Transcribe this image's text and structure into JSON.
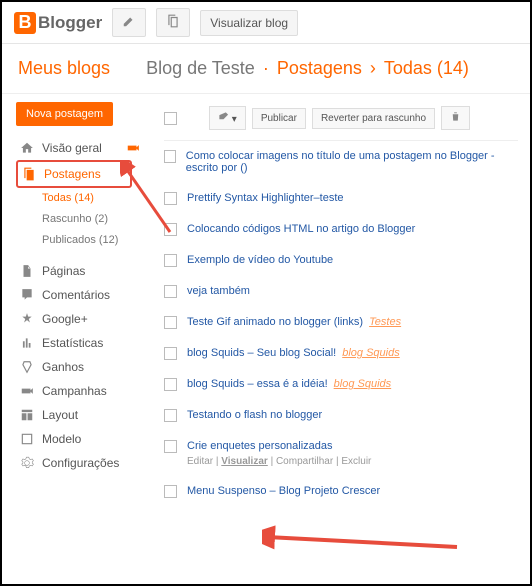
{
  "header": {
    "logo": "Blogger",
    "viewBlog": "Visualizar blog"
  },
  "title": {
    "myBlogs": "Meus blogs",
    "blogName": "Blog de Teste",
    "section": "Postagens",
    "filter": "Todas (14)"
  },
  "sidebar": {
    "newPost": "Nova postagem",
    "items": [
      {
        "label": "Visão geral"
      },
      {
        "label": "Postagens"
      },
      {
        "label": "Páginas"
      },
      {
        "label": "Comentários"
      },
      {
        "label": "Google+"
      },
      {
        "label": "Estatísticas"
      },
      {
        "label": "Ganhos"
      },
      {
        "label": "Campanhas"
      },
      {
        "label": "Layout"
      },
      {
        "label": "Modelo"
      },
      {
        "label": "Configurações"
      }
    ],
    "sub": {
      "all": "Todas (14)",
      "draft": "Rascunho (2)",
      "published": "Publicados (12)"
    }
  },
  "toolbar": {
    "publish": "Publicar",
    "revert": "Reverter para rascunho"
  },
  "posts": [
    {
      "title": "Como colocar imagens no título de uma postagem no Blogger - escrito por ()"
    },
    {
      "title": "Prettify Syntax Highlighter–teste"
    },
    {
      "title": "Colocando códigos HTML no artigo do Blogger"
    },
    {
      "title": "Exemplo de vídeo do Youtube"
    },
    {
      "title": "veja também"
    },
    {
      "title": "Teste Gif animado no blogger (links)",
      "label": "Testes"
    },
    {
      "title": "blog Squids – Seu blog Social!",
      "label": "blog Squids"
    },
    {
      "title": "blog Squids – essa é a idéia!",
      "label": "blog Squids"
    },
    {
      "title": "Testando o flash no blogger"
    },
    {
      "title": "Crie enquetes personalizadas",
      "actions": true
    },
    {
      "title": "Menu Suspenso – Blog Projeto Crescer"
    }
  ],
  "actions": {
    "edit": "Editar",
    "view": "Visualizar",
    "share": "Compartilhar",
    "del": "Excluir"
  }
}
